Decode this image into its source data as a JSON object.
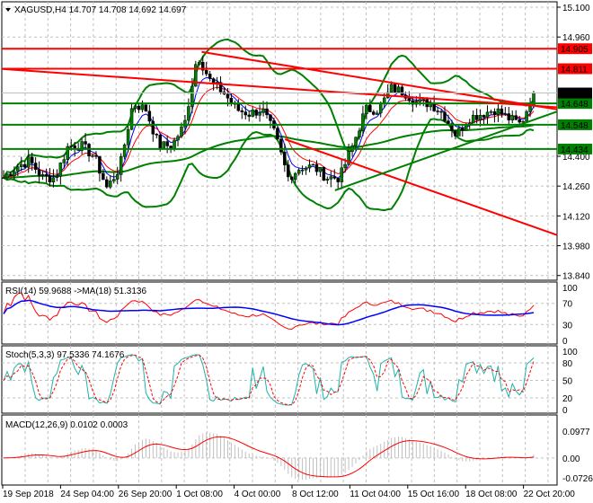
{
  "chart_data": {
    "type": "candlestick",
    "symbol_header": "XAGUSD,H4  14.707 14.708 14.692 14.697",
    "ohlc_last": {
      "open": 14.707,
      "high": 14.708,
      "low": 14.692,
      "close": 14.697
    },
    "price_ticks": [
      "15.100",
      "14.960",
      "14.400",
      "14.260",
      "14.120",
      "13.980",
      "13.840"
    ],
    "price_ylim": [
      13.84,
      15.1
    ],
    "levels": [
      {
        "label": "14.905",
        "price": 14.905,
        "color": "#ff0000"
      },
      {
        "label": "14.811",
        "price": 14.811,
        "color": "#ff0000"
      },
      {
        "label": "14.648",
        "price": 14.648,
        "color": "#008000"
      },
      {
        "label": "14.548",
        "price": 14.548,
        "color": "#008000"
      },
      {
        "label": "14.434",
        "price": 14.434,
        "color": "#008000"
      }
    ],
    "current_price": {
      "label": "14.697",
      "price": 14.697
    },
    "closes_approx": [
      14.3,
      14.35,
      14.38,
      14.3,
      14.3,
      14.45,
      14.45,
      14.4,
      14.25,
      14.35,
      14.65,
      14.62,
      14.45,
      14.45,
      14.55,
      14.88,
      14.75,
      14.7,
      14.62,
      14.6,
      14.62,
      14.5,
      14.3,
      14.35,
      14.35,
      14.3,
      14.3,
      14.45,
      14.62,
      14.62,
      14.72,
      14.7,
      14.65,
      14.65,
      14.6,
      14.5,
      14.58,
      14.6,
      14.62,
      14.58,
      14.55,
      14.697
    ],
    "trendlines": [
      {
        "color": "#ff0000",
        "from": [
          0,
          14.81
        ],
        "to": [
          1,
          14.63
        ]
      },
      {
        "color": "#ff0000",
        "from": [
          0.36,
          14.89
        ],
        "to": [
          1,
          14.62
        ]
      },
      {
        "color": "#ff0000",
        "from": [
          0.51,
          14.48
        ],
        "to": [
          1,
          14.03
        ]
      },
      {
        "color": "#008000",
        "from": [
          0.6,
          14.24
        ],
        "to": [
          1,
          14.61
        ]
      }
    ],
    "time_labels": [
      "19 Sep 2018",
      "24 Sep 04:00",
      "26 Sep 20:00",
      "1 Oct 08:00",
      "4 Oct 00:00",
      "8 Oct 12:00",
      "11 Oct 04:00",
      "15 Oct 16:00",
      "18 Oct 08:00",
      "22 Oct 20:00"
    ],
    "rsi": {
      "label": "RSI(14) 59.9688  ->MA(18) 51.3136",
      "value": 59.9688,
      "ma": 51.3136,
      "ticks": [
        "100",
        "70",
        "30",
        "0"
      ]
    },
    "stoch": {
      "label": "Stoch(5,3,3) 97.5336 74.1676",
      "main": 97.5336,
      "signal": 74.1676,
      "ticks": [
        "100",
        "80",
        "50",
        "20",
        "0"
      ]
    },
    "macd": {
      "label": "MACD(12,26,9) 0.0102 0.0003",
      "main": 0.0102,
      "signal": 0.0003,
      "ticks": [
        "0.0977",
        "0.00",
        "-0.0726"
      ]
    }
  }
}
